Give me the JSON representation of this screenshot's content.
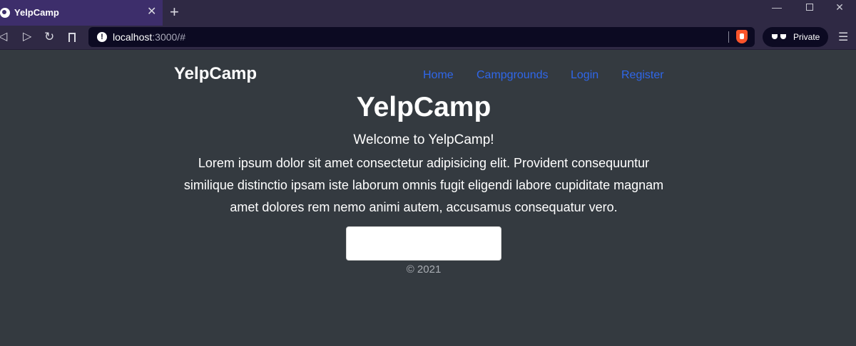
{
  "browser": {
    "tab_title": "YelpCamp",
    "tab_close": "✕",
    "new_tab": "+",
    "url_host": "localhost",
    "url_rest": ":3000/#",
    "private_label": "Private"
  },
  "navbar": {
    "brand": "YelpCamp",
    "links": [
      "Home",
      "Campgrounds",
      "Login",
      "Register"
    ]
  },
  "hero": {
    "title": "YelpCamp",
    "welcome": "Welcome to YelpCamp!",
    "lead": "Lorem ipsum dolor sit amet consectetur adipisicing elit. Provident consequuntur similique distinctio ipsam iste laborum omnis fugit eligendi labore cupiditate magnam amet dolores rem nemo animi autem, accusamus consequatur vero.",
    "button_label": ""
  },
  "footer": {
    "text": "© 2021"
  },
  "colors": {
    "page_bg": "#343a40",
    "link": "#2f67ea",
    "chrome_bg": "#2f2944",
    "active_tab": "#3d2e6b"
  },
  "icons": [
    "globe-icon",
    "close-icon",
    "plus-icon",
    "back-icon",
    "forward-icon",
    "reload-icon",
    "bookmark-icon",
    "alert-icon",
    "brave-icon",
    "glasses-icon",
    "menu-icon"
  ]
}
